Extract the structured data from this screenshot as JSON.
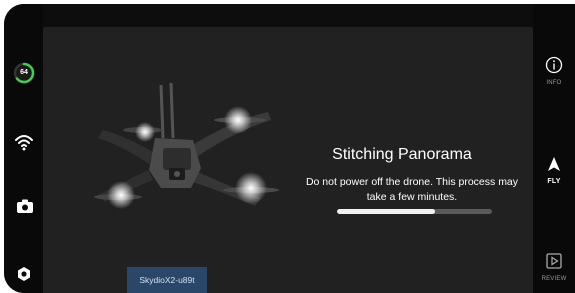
{
  "battery": {
    "percent": 64,
    "label": "64",
    "color": "#3ed14a"
  },
  "left_sidebar": {
    "icons": [
      "wifi-icon",
      "camera-icon",
      "settings-icon"
    ]
  },
  "right_sidebar": {
    "info": {
      "icon": "info-icon",
      "label": "INFO"
    },
    "fly": {
      "icon": "navigation-arrow-icon",
      "label": "FLY"
    },
    "review": {
      "icon": "play-icon",
      "label": "REVIEW"
    }
  },
  "status": {
    "title": "Stitching Panorama",
    "message": "Do not power off the drone. This process may take a few minutes.",
    "progress": 0.63
  },
  "drone_name": "SkydioX2-u89t",
  "colors": {
    "background": "#212121",
    "rail": "#090909",
    "badge": "#2a4769"
  }
}
